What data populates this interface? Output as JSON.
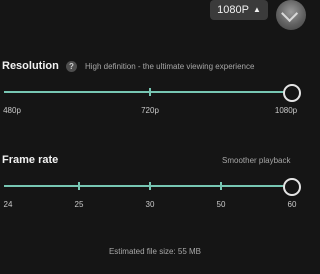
{
  "top_bar": {
    "resolution_dropdown": {
      "value": "1080P",
      "icon": "caret-up-icon"
    },
    "action_button": {
      "icon": "check-icon"
    }
  },
  "resolution": {
    "title": "Resolution",
    "help_icon": "?",
    "description": "High definition - the ultimate viewing experience",
    "labels": [
      "480p",
      "720p",
      "1080p"
    ],
    "selected": "1080p"
  },
  "frame_rate": {
    "title": "Frame rate",
    "description": "Smoother playback",
    "labels": [
      "24",
      "25",
      "30",
      "50",
      "60"
    ],
    "selected": "60"
  },
  "footer": {
    "estimate": "Estimated file size: 55 MB"
  },
  "colors": {
    "accent": "#77c6b3",
    "background": "#151515",
    "thumb": "#e4e4e4"
  }
}
